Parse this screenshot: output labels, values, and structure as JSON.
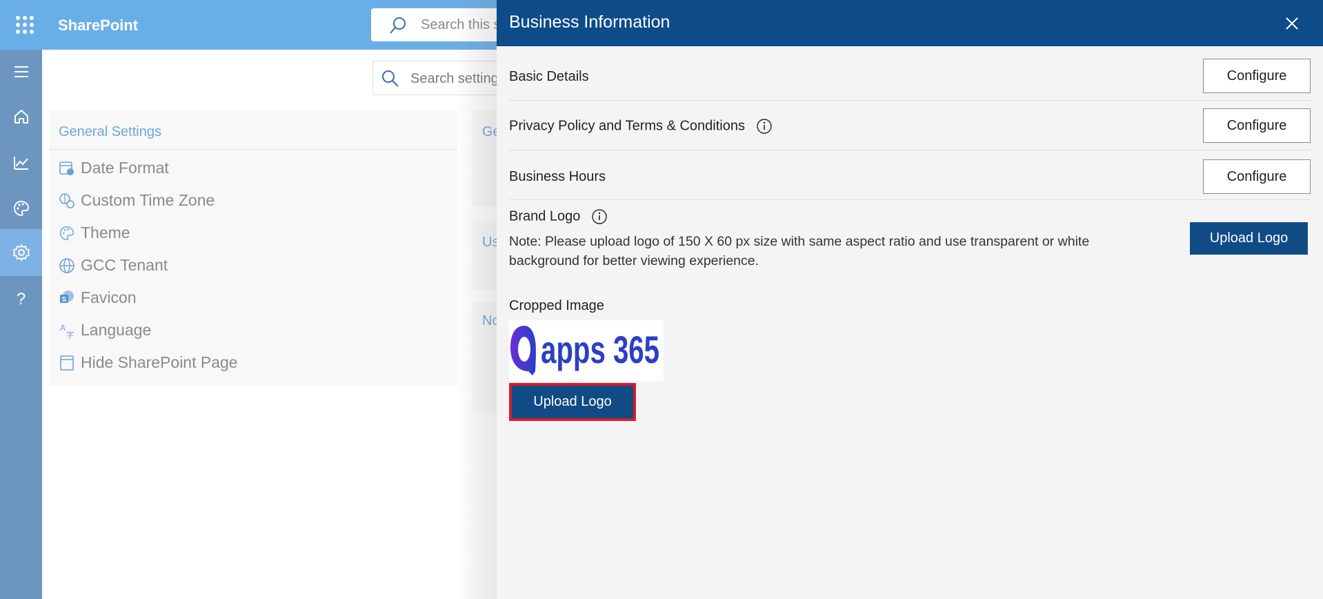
{
  "app": {
    "brand": "SharePoint",
    "top_search_placeholder": "Search this s"
  },
  "rail": {
    "items": [
      "menu",
      "home",
      "analytics",
      "theme",
      "settings",
      "help"
    ],
    "active": "settings"
  },
  "settings_page": {
    "search_placeholder": "Search setting",
    "general_settings": {
      "title": "General Settings",
      "items": [
        {
          "label": "Date Format",
          "icon": "calendar-clock-icon"
        },
        {
          "label": "Custom Time Zone",
          "icon": "globe-clock-icon"
        },
        {
          "label": "Theme",
          "icon": "palette-icon"
        },
        {
          "label": "GCC Tenant",
          "icon": "globe-icon"
        },
        {
          "label": "Favicon",
          "icon": "sharepoint-icon"
        },
        {
          "label": "Language",
          "icon": "translate-icon"
        },
        {
          "label": "Hide SharePoint Page",
          "icon": "page-icon"
        }
      ]
    },
    "second_column_fragments": [
      "Ge",
      "Us",
      "No"
    ]
  },
  "panel": {
    "title": "Business Information",
    "rows": [
      {
        "label": "Basic Details",
        "button": "Configure",
        "info": false
      },
      {
        "label": "Privacy Policy and Terms & Conditions",
        "button": "Configure",
        "info": true
      },
      {
        "label": "Business Hours",
        "button": "Configure",
        "info": false
      }
    ],
    "brand_logo": {
      "label": "Brand Logo",
      "note": "Note: Please upload logo of 150 X 60 px size with same aspect ratio and use transparent or white background for better viewing experience.",
      "upload_label": "Upload Logo",
      "cropped_label": "Cropped Image",
      "logo_text": "apps 365",
      "upload_label_2": "Upload Logo"
    }
  },
  "colors": {
    "topbar": "#6aaee8",
    "rail": "#6c96c0",
    "panel_header": "#0e4b89",
    "primary_button": "#104b86",
    "highlight_border": "#d41e2a"
  }
}
